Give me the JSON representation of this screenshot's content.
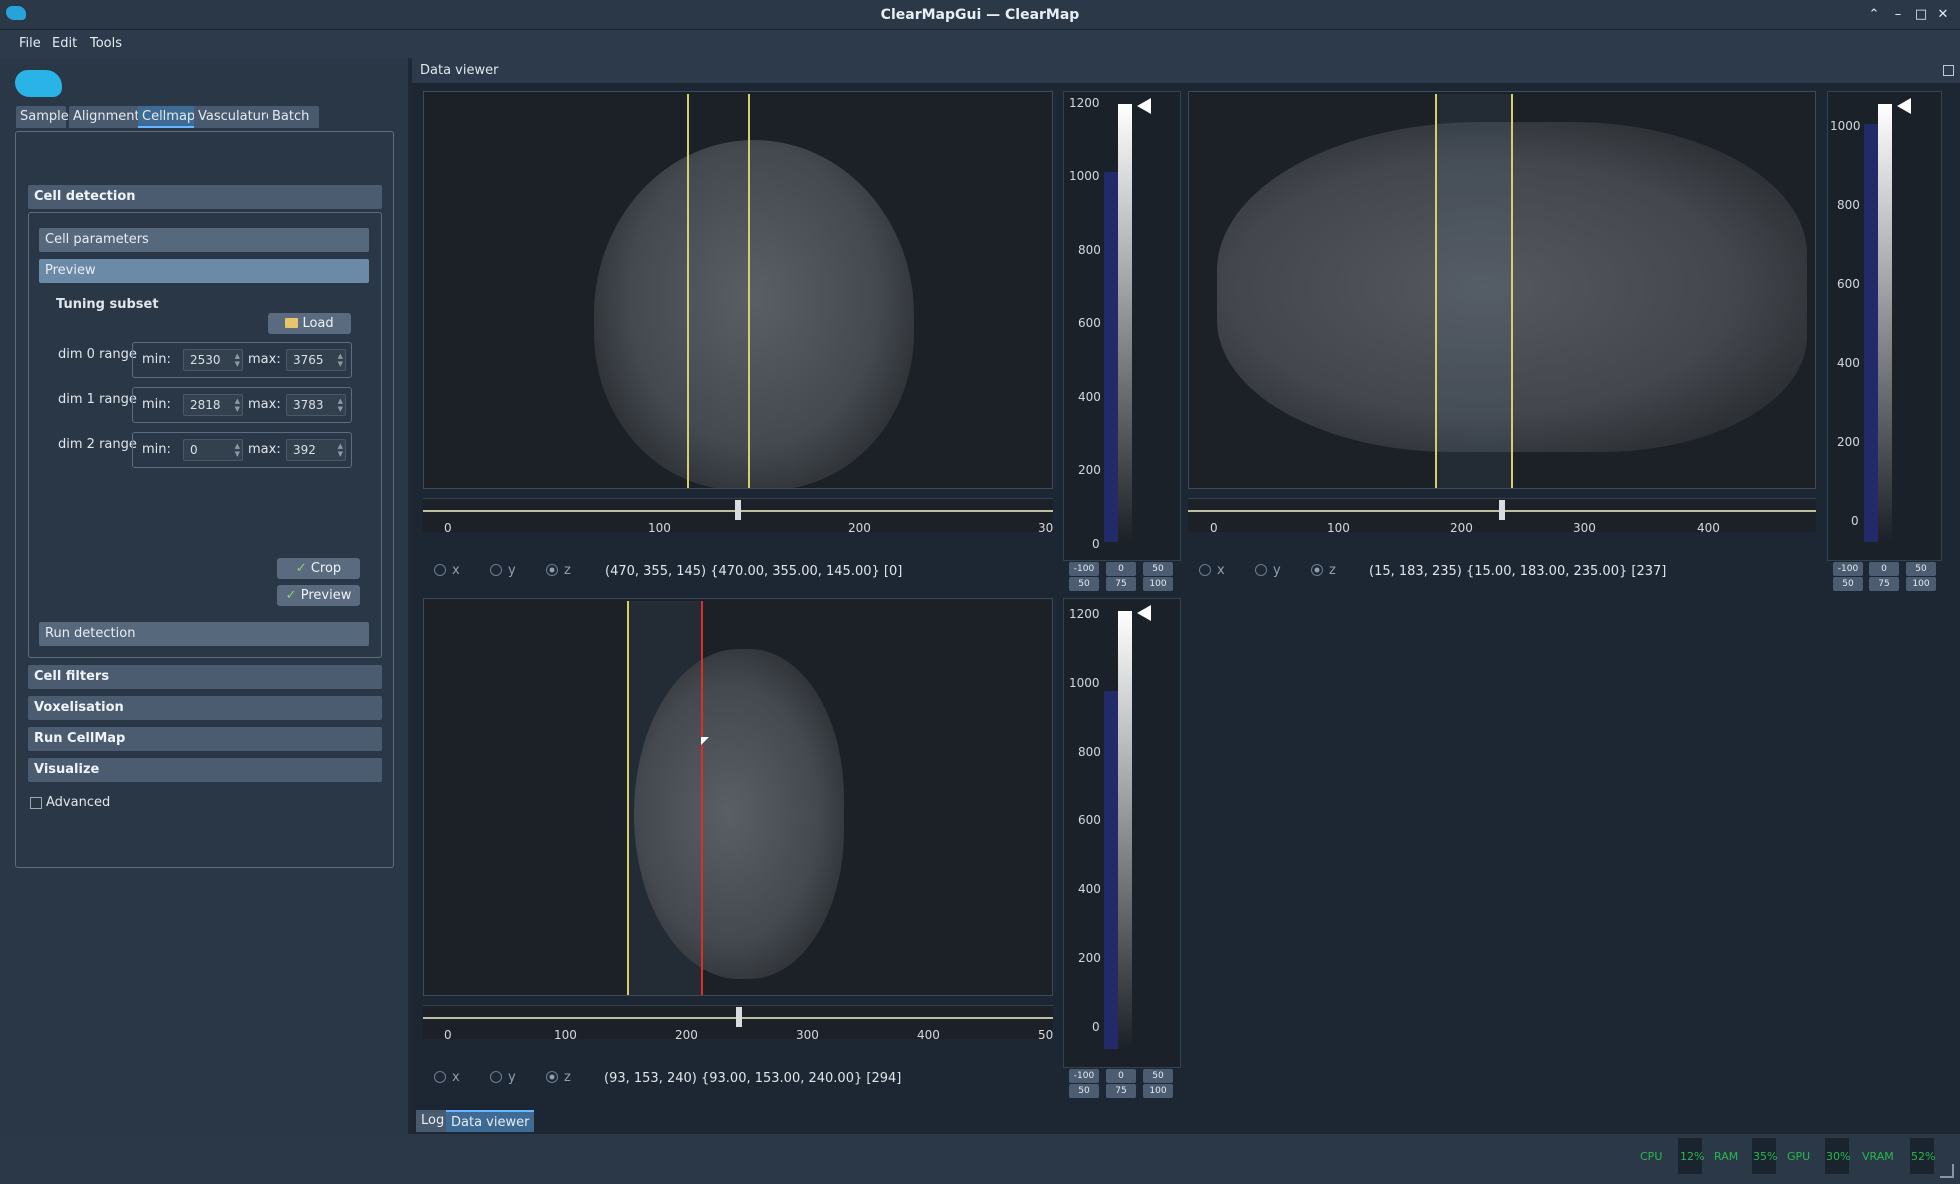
{
  "window": {
    "title": "ClearMapGui — ClearMap",
    "controls": [
      "⌃",
      "–",
      "□",
      "✕"
    ]
  },
  "menu": [
    "File",
    "Edit",
    "Tools"
  ],
  "left_tabs": [
    "Sample",
    "Alignment",
    "Cellmap",
    "Vasculature",
    "Batch"
  ],
  "active_tab": "Cellmap",
  "sections": {
    "cell_detection": "Cell detection",
    "cell_parameters": "Cell parameters",
    "preview": "Preview",
    "tuning_subset": "Tuning subset",
    "load_button": "Load",
    "dims": [
      {
        "label": "dim 0 range",
        "min_label": "min:",
        "min": "2530",
        "max_label": "max:",
        "max": "3765"
      },
      {
        "label": "dim 1 range",
        "min_label": "min:",
        "min": "2818",
        "max_label": "max:",
        "max": "3783"
      },
      {
        "label": "dim 2 range",
        "min_label": "min:",
        "min": "0",
        "max_label": "max:",
        "max": "392"
      }
    ],
    "crop_button": "Crop",
    "preview_button": "Preview",
    "run_detection": "Run detection",
    "cell_filters": "Cell filters",
    "voxelisation": "Voxelisation",
    "run_cellmap": "Run CellMap",
    "visualize": "Visualize",
    "advanced_label": "Advanced"
  },
  "data_viewer": {
    "title": "Data viewer"
  },
  "viewers": [
    {
      "slider_ticks": [
        "0",
        "100",
        "200",
        "30"
      ],
      "slider_fraction": 0.5,
      "axes": [
        "x",
        "y",
        "z"
      ],
      "selected_axis": "z",
      "coords": "(470, 355, 145) {470.00, 355.00, 145.00} [0]",
      "hist_ticks": [
        "1200",
        "1000",
        "800",
        "600",
        "400",
        "200",
        "0"
      ],
      "mini_buttons": [
        [
          "-100",
          "0",
          "50"
        ],
        [
          "50",
          "75",
          "100"
        ]
      ]
    },
    {
      "slider_ticks": [
        "0",
        "100",
        "200",
        "300",
        "400"
      ],
      "slider_fraction": 0.5,
      "axes": [
        "x",
        "y",
        "z"
      ],
      "selected_axis": "z",
      "coords": "(15, 183, 235) {15.00, 183.00, 235.00} [237]",
      "hist_ticks": [
        "1000",
        "800",
        "600",
        "400",
        "200",
        "0"
      ],
      "mini_buttons": [
        [
          "-100",
          "0",
          "50"
        ],
        [
          "50",
          "75",
          "100"
        ]
      ]
    },
    {
      "slider_ticks": [
        "0",
        "100",
        "200",
        "300",
        "400",
        "50"
      ],
      "slider_fraction": 0.5,
      "axes": [
        "x",
        "y",
        "z"
      ],
      "selected_axis": "z",
      "coords": "(93, 153, 240) {93.00, 153.00, 240.00} [294]",
      "hist_ticks": [
        "1200",
        "1000",
        "800",
        "600",
        "400",
        "200",
        "0"
      ],
      "mini_buttons": [
        [
          "-100",
          "0",
          "50"
        ],
        [
          "50",
          "75",
          "100"
        ]
      ]
    }
  ],
  "bottom_tabs": [
    "Log",
    "Data viewer"
  ],
  "active_bottom_tab": "Data viewer",
  "status": [
    "CPU",
    "12%",
    "RAM",
    "35%",
    "GPU",
    "30%",
    "VRAM",
    "52%"
  ],
  "colors": {
    "accent": "#67b6ff",
    "crosshair": "#d8cf6a",
    "cursor_line": "#e02b2b",
    "status_green": "#29b84f"
  }
}
